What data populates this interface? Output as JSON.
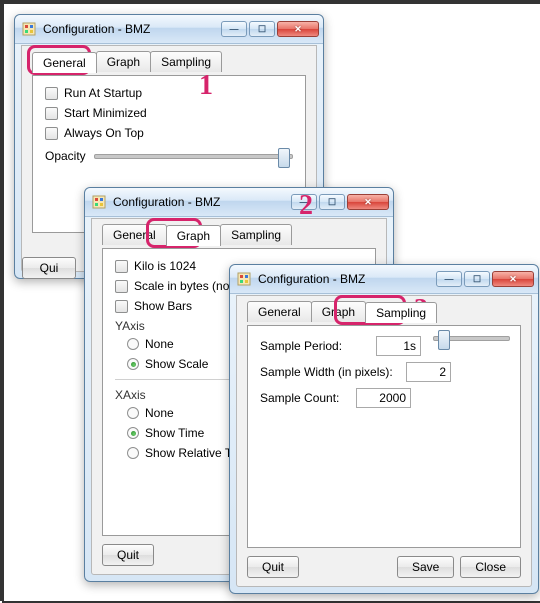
{
  "window_title": "Configuration - BMZ",
  "tabs": {
    "general": "General",
    "graph": "Graph",
    "sampling": "Sampling"
  },
  "general": {
    "run_at_startup": "Run At Startup",
    "start_minimized": "Start Minimized",
    "always_on_top": "Always On Top",
    "opacity": "Opacity"
  },
  "graph": {
    "kilo": "Kilo is 1024",
    "scale_bytes": "Scale in bytes (not bits)",
    "show_bars": "Show Bars",
    "yaxis_label": "YAxis",
    "yaxis_none": "None",
    "yaxis_show_scale": "Show Scale",
    "xaxis_label": "XAxis",
    "xaxis_none": "None",
    "xaxis_show_time": "Show Time",
    "xaxis_show_rel": "Show Relative Time"
  },
  "sampling": {
    "period_label": "Sample Period:",
    "period_value": "1s",
    "width_label": "Sample Width (in pixels):",
    "width_value": "2",
    "count_label": "Sample Count:",
    "count_value": "2000"
  },
  "buttons": {
    "quit": "Quit",
    "save": "Save",
    "close": "Close"
  },
  "callouts": {
    "one": "1",
    "two": "2",
    "three": "3"
  }
}
